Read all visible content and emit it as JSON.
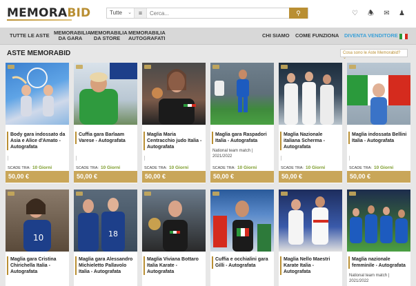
{
  "header": {
    "logo_main": "MEMORA",
    "logo_accent": "BID",
    "search": {
      "category": "Tutte",
      "placeholder": "Cerca...",
      "value": ""
    }
  },
  "nav": {
    "items": [
      {
        "label": "TUTTE LE ASTE"
      },
      {
        "label1": "MEMORABILIA",
        "label2": "DA GARA"
      },
      {
        "label1": "MEMORABILIA",
        "label2": "DA STORE"
      },
      {
        "label1": "MEMORABILIA",
        "label2": "AUTOGRAFATI"
      }
    ],
    "right": [
      "CHI SIAMO",
      "COME FUNZIONA",
      "DIVENTA VENDITORE"
    ]
  },
  "section": {
    "title": "ASTE MEMORABID",
    "help": "Cosa sono le Aste Memorabid?"
  },
  "colors": {
    "accent": "#b98f33",
    "price_bar": "#c9a659",
    "days_green": "#7a9a28",
    "vendor_blue": "#3ba1d8"
  },
  "cards_row1": [
    {
      "title": "Body gara indossato da Asia e Alice d'Amato - Autografata",
      "sub": "",
      "scade": "SCADE TRA:",
      "days": "10 Giorni",
      "price": "50,00 €"
    },
    {
      "title": "Cuffia gara Barlaam Varese - Autografata",
      "sub": "",
      "scade": "SCADE TRA:",
      "days": "10 Giorni",
      "price": "50,00 €"
    },
    {
      "title": "Maglia Maria Centracchio judo Italia - Autografata",
      "sub": "",
      "scade": "SCADE TRA:",
      "days": "10 Giorni",
      "price": "50,00 €"
    },
    {
      "title": "Maglia gara Raspadori Italia - Autografata",
      "sub": "National team match | 2021/2022",
      "scade": "SCADE TRA:",
      "days": "10 Giorni",
      "price": "50,00 €"
    },
    {
      "title": "Maglia Nazionale italiana Scherma - Autografata",
      "sub": "",
      "scade": "SCADE TRA:",
      "days": "10 Giorni",
      "price": "50,00 €"
    },
    {
      "title": "Maglia indossata Bellini Italia - Autografata",
      "sub": "",
      "scade": "SCADE TRA:",
      "days": "10 Giorni",
      "price": "50,00 €"
    }
  ],
  "cards_row2": [
    {
      "title": "Maglia gara Cristina Chirichella Italia - Autografata"
    },
    {
      "title": "Maglia gara Alessandro Michieletto Pallavolo Italia - Autografata"
    },
    {
      "title": "Maglia Viviana Bottaro Italia Karate - Autografata"
    },
    {
      "title": "Cuffia e occhialini gara Gilli - Autografata"
    },
    {
      "title": "Maglia Nello Maestri Karate Italia - Autografata"
    },
    {
      "title": "Maglia nazionale femminile - Autografata",
      "sub": "National team match | 2021/2022"
    }
  ]
}
